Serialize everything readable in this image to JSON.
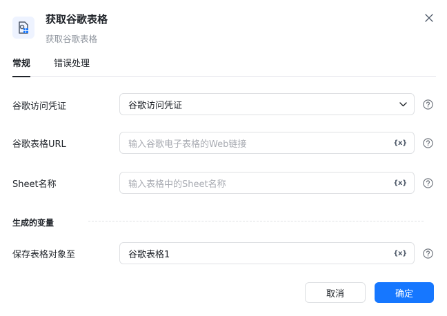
{
  "header": {
    "title": "获取谷歌表格",
    "subtitle": "获取谷歌表格",
    "icon": "google-sheet-icon"
  },
  "tabs": [
    {
      "label": "常规",
      "active": true
    },
    {
      "label": "错误处理",
      "active": false
    }
  ],
  "form": {
    "credential": {
      "label": "谷歌访问凭证",
      "value": "谷歌访问凭证"
    },
    "url": {
      "label": "谷歌表格URL",
      "placeholder": "输入谷歌电子表格的Web链接",
      "var_label": "{x}"
    },
    "sheet": {
      "label": "Sheet名称",
      "placeholder": "输入表格中的Sheet名称",
      "var_label": "{x}"
    }
  },
  "output_section": {
    "title": "生成的变量",
    "save_to": {
      "label": "保存表格对象至",
      "value": "谷歌表格1",
      "var_label": "{x}"
    }
  },
  "footer": {
    "cancel_label": "取消",
    "ok_label": "确定"
  },
  "colors": {
    "primary": "#1677ff",
    "text": "#1f2329",
    "muted": "#8f959e"
  }
}
